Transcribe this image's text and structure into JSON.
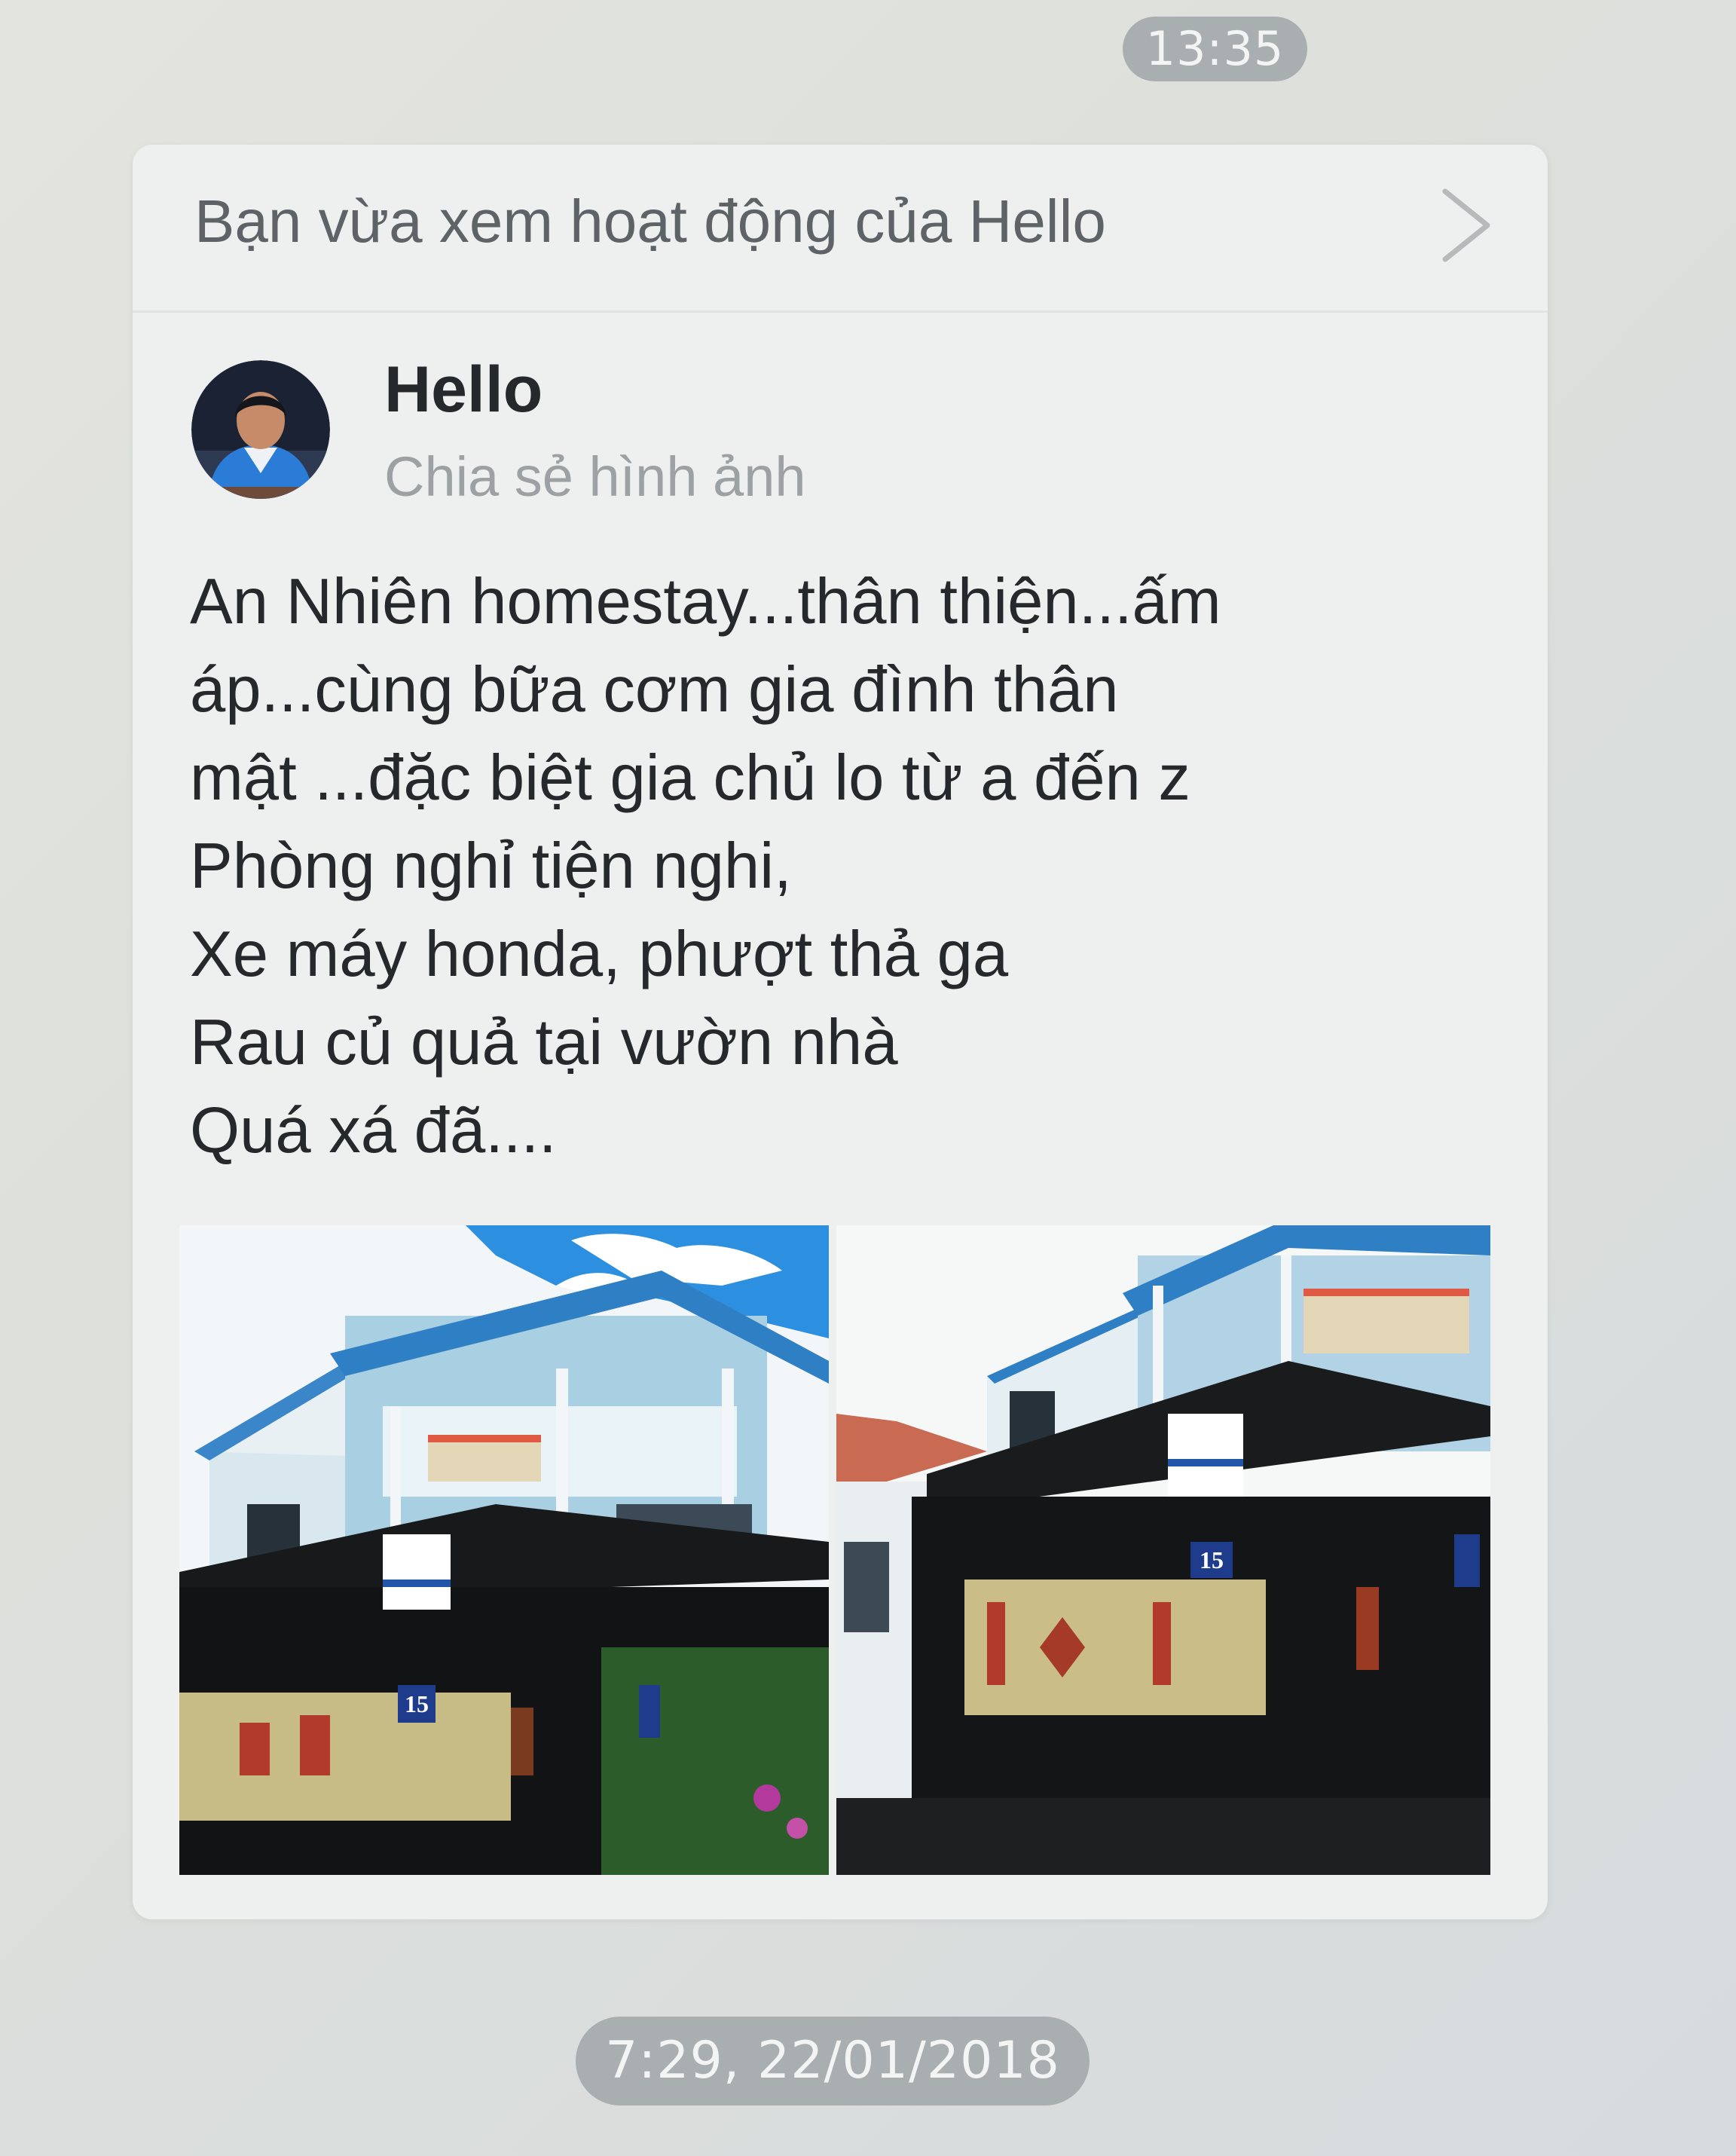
{
  "chat": {
    "time_top": "13:35",
    "time_bottom": "7:29, 22/01/2018"
  },
  "activity_card": {
    "header": "Bạn vừa xem hoạt động của Hello",
    "chevron_icon": "chevron-right-icon",
    "poster": {
      "name": "Hello",
      "action": "Chia sẻ hình ảnh",
      "avatar_icon": "profile-photo"
    },
    "text_lines": [
      "An Nhiên homestay...thân thiện...ấm",
      "áp...cùng bữa cơm gia đình thân",
      "mật ...đặc biệt gia chủ lo từ a đến z",
      "Phòng nghỉ tiện nghi,",
      "Xe máy honda, phượt thả ga",
      "Rau củ quả tại vườn nhà",
      "Quá xá đã...."
    ],
    "photos": [
      {
        "house_number": "15"
      },
      {
        "house_number": "15"
      }
    ]
  },
  "colors": {
    "background": "#dfe1dd",
    "card": "#eef0ef",
    "time_pill": "#a9aeb0",
    "text_primary": "#25292c",
    "text_secondary": "#9ca1a3"
  }
}
